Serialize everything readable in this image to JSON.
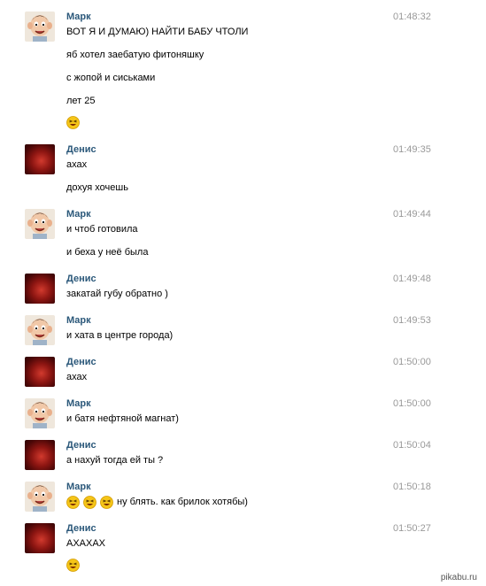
{
  "messages": [
    {
      "author": "Марк",
      "time": "01:48:32",
      "lines": [
        "ВОТ Я И ДУМАЮ) НАЙТИ БАБУ ЧТОЛИ",
        "яб хотел заебатую фитоняшку",
        "с жопой и сиськами",
        "лет 25"
      ],
      "emoji_count": 1
    },
    {
      "author": "Денис",
      "time": "01:49:35",
      "lines": [
        "ахах",
        "дохуя хочешь"
      ]
    },
    {
      "author": "Марк",
      "time": "01:49:44",
      "lines": [
        "и чтоб готовила",
        "и беха у неё была"
      ]
    },
    {
      "author": "Денис",
      "time": "01:49:48",
      "lines": [
        "закатай губу обратно )"
      ]
    },
    {
      "author": "Марк",
      "time": "01:49:53",
      "lines": [
        "и хата в центре города)"
      ]
    },
    {
      "author": "Денис",
      "time": "01:50:00",
      "lines": [
        "ахах"
      ]
    },
    {
      "author": "Марк",
      "time": "01:50:00",
      "lines": [
        "и батя нефтяной магнат)"
      ]
    },
    {
      "author": "Денис",
      "time": "01:50:04",
      "lines": [
        "а нахуй тогда ей ты ?"
      ]
    },
    {
      "author": "Марк",
      "time": "01:50:18",
      "inline_emoji_count": 3,
      "lines": [
        "ну блять. как брилок хотябы)"
      ]
    },
    {
      "author": "Денис",
      "time": "01:50:27",
      "lines": [
        "АХАХАХ"
      ],
      "emoji_count": 1
    }
  ],
  "watermark": "pikabu.ru",
  "colors": {
    "author": "#2b587a",
    "time": "#999999",
    "emoji": "#f5c518"
  }
}
